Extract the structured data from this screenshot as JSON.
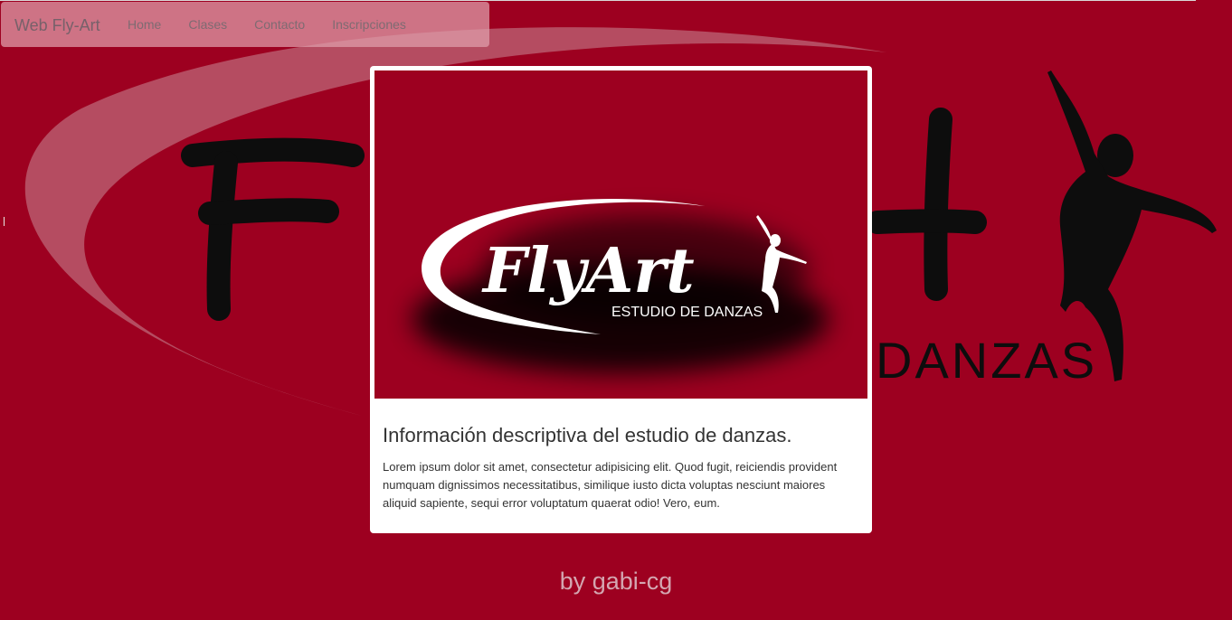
{
  "navbar": {
    "brand": "Web Fly-Art",
    "links": [
      "Home",
      "Clases",
      "Contacto",
      "Inscripciones"
    ]
  },
  "background": {
    "logo_text": "FlyArt",
    "subtitle_text": "DANZAS"
  },
  "card": {
    "logo_text": "FlyArt",
    "logo_subtitle": "ESTUDIO DE DANZAS",
    "title": "Información descriptiva del estudio de danzas.",
    "body": "Lorem ipsum dolor sit amet, consectetur adipisicing elit. Quod fugit, reiciendis provident numquam dignissimos necessitatibus, similique iusto dicta voluptas nesciunt maiores aliquid sapiente, sequi error voluptatum quaerat odio! Vero, eum."
  },
  "footer": {
    "text": "by gabi-cg"
  },
  "colors": {
    "background": "#9d0020",
    "card": "#ffffff",
    "text": "#333333",
    "footer": "#d4a6b1"
  }
}
